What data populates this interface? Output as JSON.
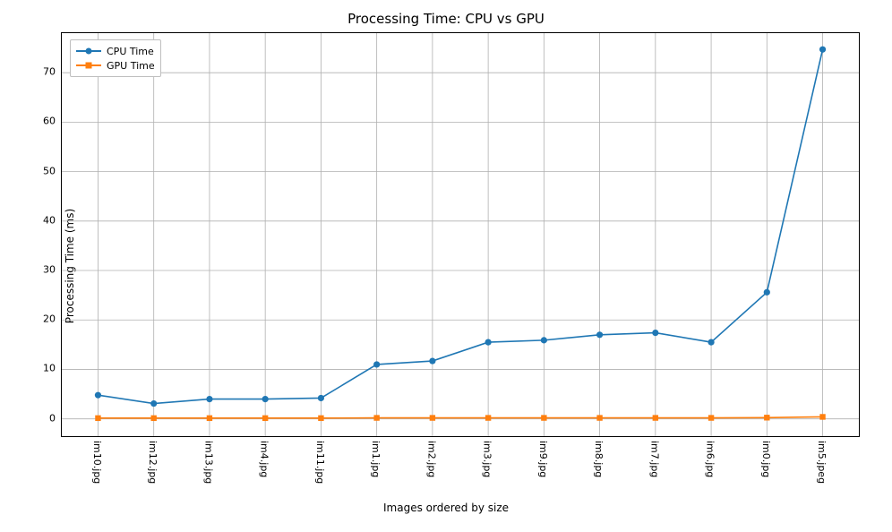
{
  "chart_data": {
    "type": "line",
    "title": "Processing Time: CPU vs GPU",
    "xlabel": "Images ordered by size",
    "ylabel": "Processing Time (ms)",
    "categories": [
      "im10.jpg",
      "im12.jpg",
      "im13.jpg",
      "im4.jpg",
      "im11.jpg",
      "im1.jpg",
      "im2.jpg",
      "im3.jpg",
      "im9.jpg",
      "im8.jpg",
      "im7.jpg",
      "im6.jpg",
      "im0.jpg",
      "im5.jpeg"
    ],
    "series": [
      {
        "name": "CPU Time",
        "color": "#1f77b4",
        "marker": "circle",
        "values": [
          4.8,
          3.1,
          4.0,
          4.0,
          4.2,
          11.0,
          11.7,
          15.5,
          15.9,
          17.0,
          17.4,
          15.5,
          25.6,
          74.7
        ]
      },
      {
        "name": "GPU Time",
        "color": "#ff7f0e",
        "marker": "square",
        "values": [
          0.15,
          0.15,
          0.15,
          0.15,
          0.15,
          0.2,
          0.2,
          0.2,
          0.2,
          0.2,
          0.2,
          0.2,
          0.25,
          0.4
        ]
      }
    ],
    "yticks": [
      0,
      10,
      20,
      30,
      40,
      50,
      60,
      70
    ],
    "ylim": [
      -3.5,
      78
    ],
    "xlim": [
      -0.65,
      13.65
    ],
    "grid": true,
    "legend_loc": "upper left"
  }
}
